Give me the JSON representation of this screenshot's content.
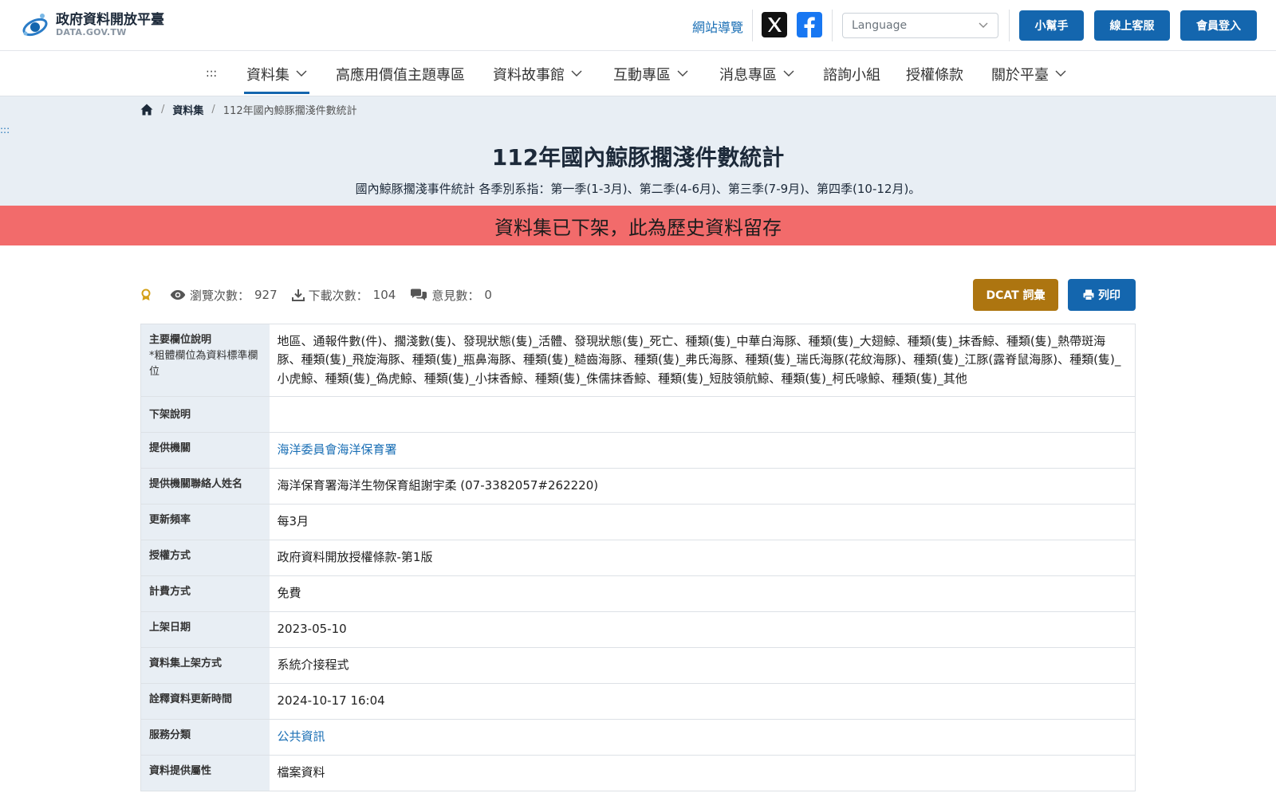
{
  "header": {
    "logo_cn": "政府資料開放平臺",
    "logo_en": "DATA.GOV.TW",
    "sitemap_label": "網站導覽",
    "language_placeholder": "Language",
    "help_label": "小幫手",
    "service_label": "線上客服",
    "login_label": "會員登入"
  },
  "nav": {
    "accesskey": ":::",
    "items": [
      {
        "label": "資料集",
        "dropdown": true
      },
      {
        "label": "高應用價值主題專區",
        "dropdown": false
      },
      {
        "label": "資料故事館",
        "dropdown": true
      },
      {
        "label": "互動專區",
        "dropdown": true
      },
      {
        "label": "消息專區",
        "dropdown": true
      },
      {
        "label": "諮詢小組",
        "dropdown": false
      },
      {
        "label": "授權條款",
        "dropdown": false
      },
      {
        "label": "關於平臺",
        "dropdown": true
      }
    ]
  },
  "breadcrumb": {
    "items": [
      "資料集",
      "112年國內鯨豚擱淺件數統計"
    ]
  },
  "side_accesskey": ":::",
  "page": {
    "title": "112年國內鯨豚擱淺件數統計",
    "description": "國內鯨豚擱淺事件統計 各季別系指：第一季(1-3月)、第二季(4-6月)、第三季(7-9月)、第四季(10-12月)。",
    "alert": "資料集已下架，此為歷史資料留存"
  },
  "stats": {
    "views_label": "瀏覽次數：",
    "views": "927",
    "downloads_label": "下載次數：",
    "downloads": "104",
    "comments_label": "意見數：",
    "comments": "0"
  },
  "buttons": {
    "dcat": "DCAT 詞彙",
    "print": "列印"
  },
  "table": {
    "fields_label": "主要欄位說明",
    "fields_note": "*粗體欄位為資料標準欄位",
    "fields_value": "地區、通報件數(件)、擱淺數(隻)、發現狀態(隻)_活體、發現狀態(隻)_死亡、種類(隻)_中華白海豚、種類(隻)_大翅鯨、種類(隻)_抹香鯨、種類(隻)_熱帶斑海豚、種類(隻)_飛旋海豚、種類(隻)_瓶鼻海豚、種類(隻)_糙齒海豚、種類(隻)_弗氏海豚、種類(隻)_瑞氏海豚(花紋海豚)、種類(隻)_江豚(露脊鼠海豚)、種類(隻)_小虎鯨、種類(隻)_偽虎鯨、種類(隻)_小抹香鯨、種類(隻)_侏儒抹香鯨、種類(隻)_短肢領航鯨、種類(隻)_柯氏喙鯨、種類(隻)_其他",
    "rows": [
      {
        "label": "下架說明",
        "value": ""
      },
      {
        "label": "提供機關",
        "value": "海洋委員會海洋保育署"
      },
      {
        "label": "提供機關聯絡人姓名",
        "value": "海洋保育署海洋生物保育組謝宇柔 (07-3382057#262220)"
      },
      {
        "label": "更新頻率",
        "value": "每3月"
      },
      {
        "label": "授權方式",
        "value": "政府資料開放授權條款-第1版"
      },
      {
        "label": "計費方式",
        "value": "免費"
      },
      {
        "label": "上架日期",
        "value": "2023-05-10"
      },
      {
        "label": "資料集上架方式",
        "value": "系統介接程式"
      },
      {
        "label": "詮釋資料更新時間",
        "value": "2024-10-17 16:04"
      },
      {
        "label": "服務分類",
        "value": "公共資訊"
      },
      {
        "label": "資料提供屬性",
        "value": "檔案資料"
      }
    ]
  },
  "colors": {
    "primary": "#1466ae",
    "dcat": "#ad7510",
    "alert": "#f26b6b",
    "hero_bg": "#e8eef4",
    "link": "#1a6fb5"
  }
}
